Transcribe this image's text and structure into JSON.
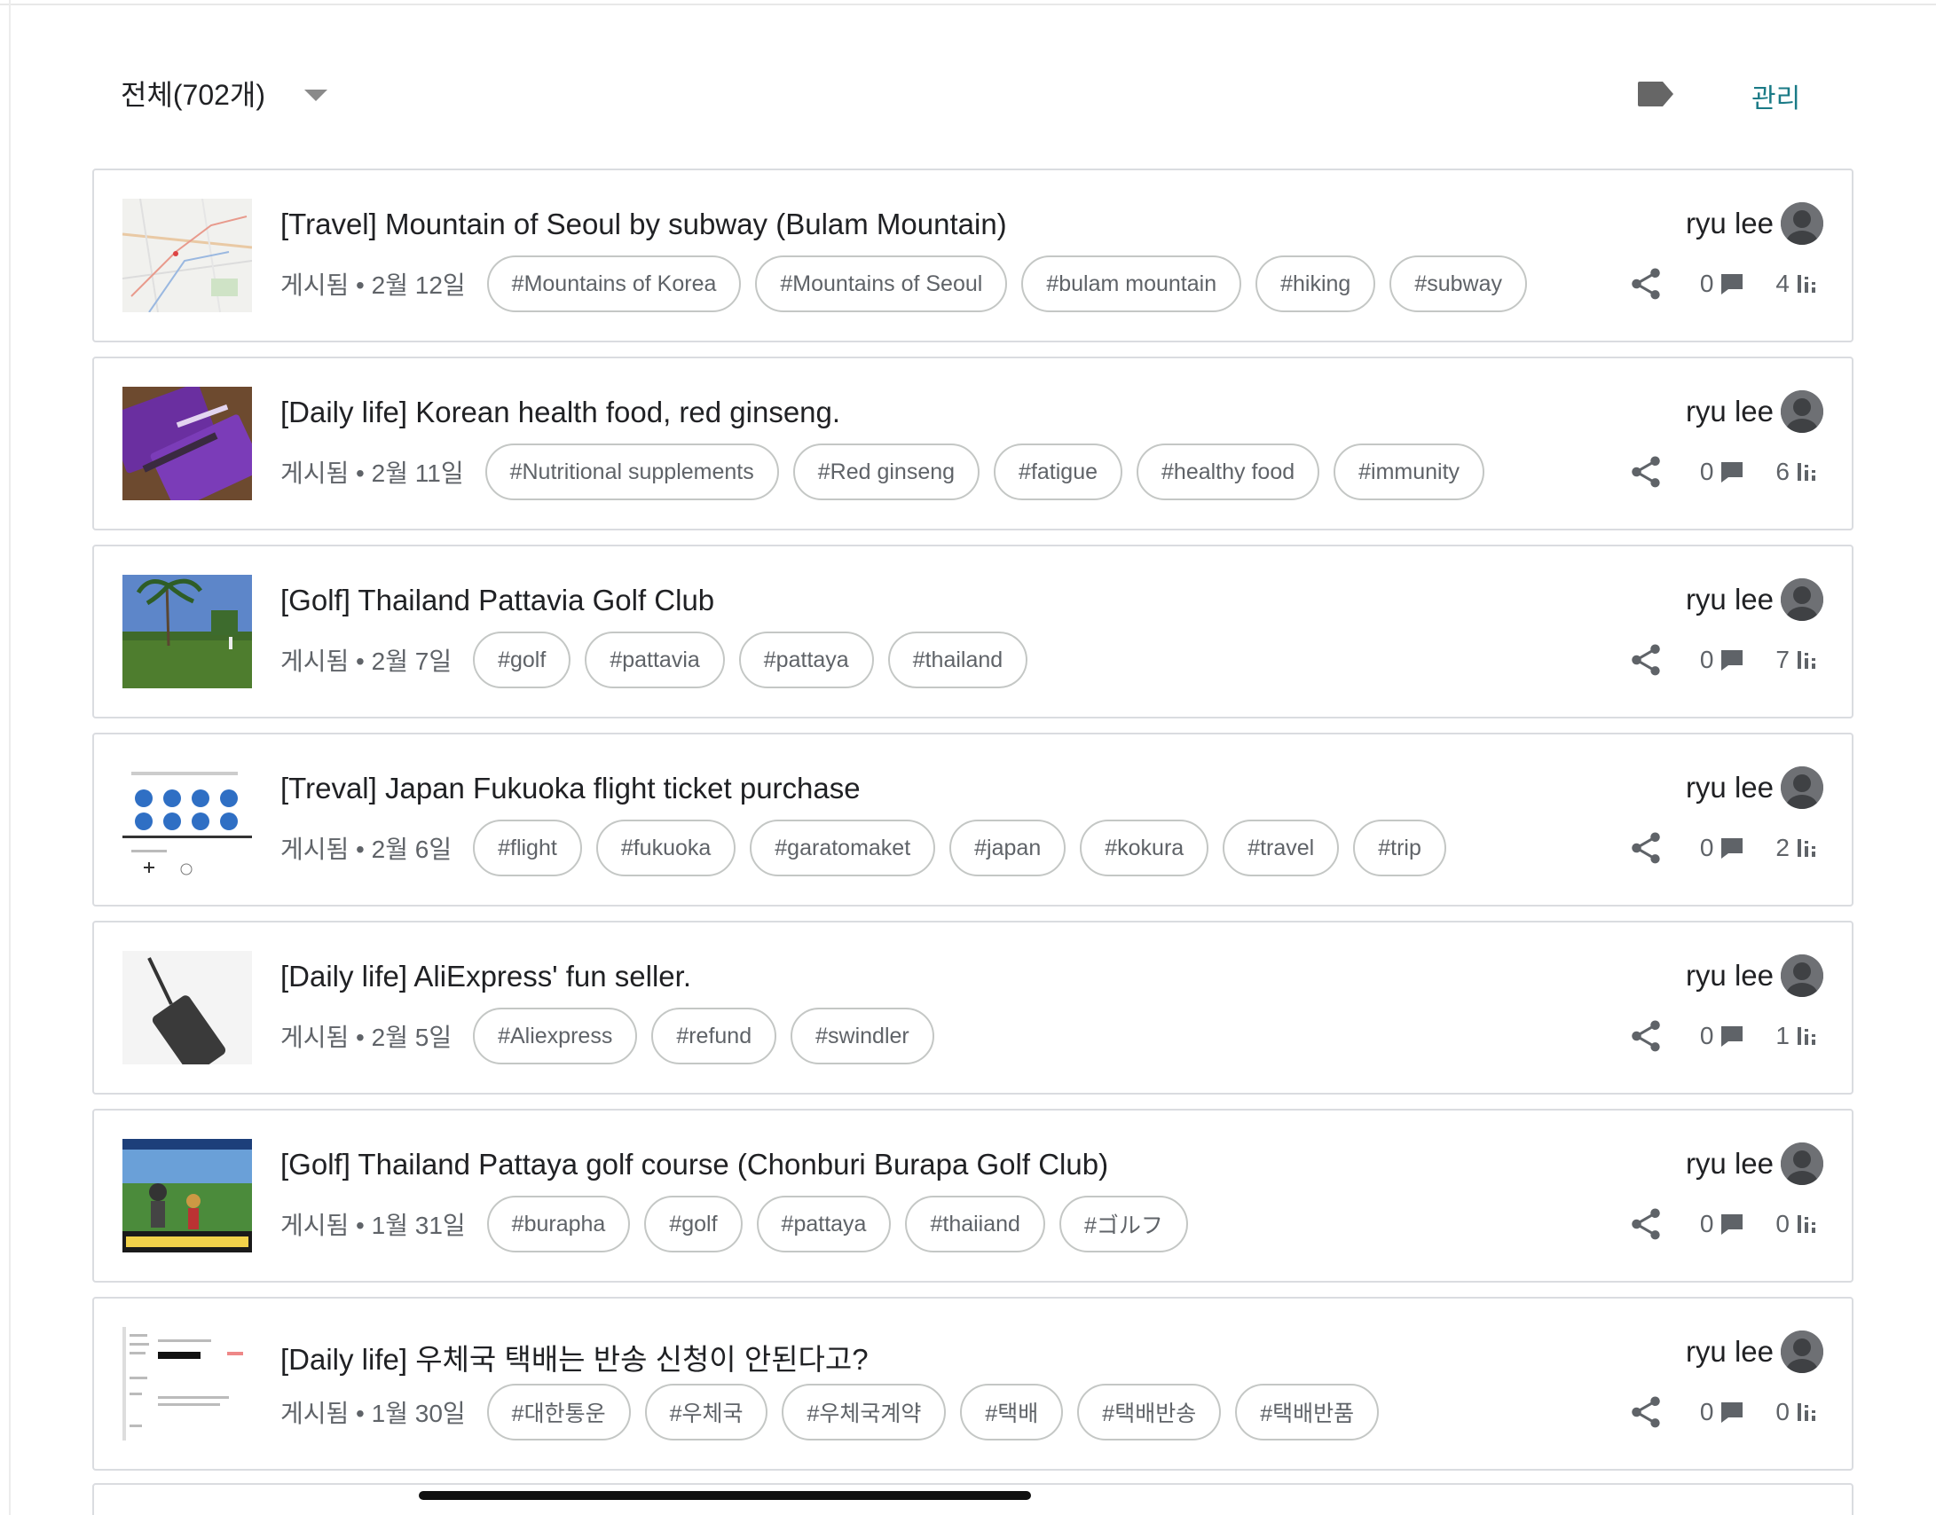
{
  "header": {
    "filter_label": "전체(702개)",
    "manage_label": "관리"
  },
  "posts": [
    {
      "title": "[Travel] Mountain of Seoul by subway (Bulam Mountain)",
      "date": "게시됨 • 2월 12일",
      "tags": [
        "#Mountains of Korea",
        "#Mountains of Seoul",
        "#bulam mountain",
        "#hiking",
        "#subway"
      ],
      "author": "ryu lee",
      "comments": "0",
      "views": "4",
      "thumb": "map"
    },
    {
      "title": "[Daily life] Korean health food, red ginseng.",
      "date": "게시됨 • 2월 11일",
      "tags": [
        "#Nutritional supplements",
        "#Red ginseng",
        "#fatigue",
        "#healthy food",
        "#immunity"
      ],
      "author": "ryu lee",
      "comments": "0",
      "views": "6",
      "thumb": "ginseng"
    },
    {
      "title": "[Golf] Thailand Pattavia Golf Club",
      "date": "게시됨 • 2월 7일",
      "tags": [
        "#golf",
        "#pattavia",
        "#pattaya",
        "#thailand"
      ],
      "author": "ryu lee",
      "comments": "0",
      "views": "7",
      "thumb": "golf"
    },
    {
      "title": "[Treval] Japan Fukuoka flight ticket purchase",
      "date": "게시됨 • 2월 6일",
      "tags": [
        "#flight",
        "#fukuoka",
        "#garatomaket",
        "#japan",
        "#kokura",
        "#travel",
        "#trip"
      ],
      "author": "ryu lee",
      "comments": "0",
      "views": "2",
      "thumb": "flight"
    },
    {
      "title": "[Daily life] AliExpress' fun seller.",
      "date": "게시됨 • 2월 5일",
      "tags": [
        "#Aliexpress",
        "#refund",
        "#swindler"
      ],
      "author": "ryu lee",
      "comments": "0",
      "views": "1",
      "thumb": "device"
    },
    {
      "title": "[Golf] Thailand Pattaya golf course (Chonburi Burapa Golf Club)",
      "date": "게시됨 • 1월 31일",
      "tags": [
        "#burapha",
        "#golf",
        "#pattaya",
        "#thaiiand",
        "#ゴルフ"
      ],
      "author": "ryu lee",
      "comments": "0",
      "views": "0",
      "thumb": "golf2"
    },
    {
      "title": "[Daily life] 우체국 택배는 반송 신청이 안된다고?",
      "date": "게시됨 • 1월 30일",
      "tags": [
        "#대한통운",
        "#우체국",
        "#우체국계약",
        "#택배",
        "#택배반송",
        "#택배반품"
      ],
      "author": "ryu lee",
      "comments": "0",
      "views": "0",
      "thumb": "doc"
    }
  ],
  "icons": {
    "filter": "chevron-down-icon",
    "label": "label-icon",
    "share": "share-icon",
    "comment": "comment-icon",
    "views": "bar-chart-icon"
  },
  "colors": {
    "accent": "#1a7a86",
    "border": "#dadce0",
    "muted_text": "#5f6368"
  }
}
